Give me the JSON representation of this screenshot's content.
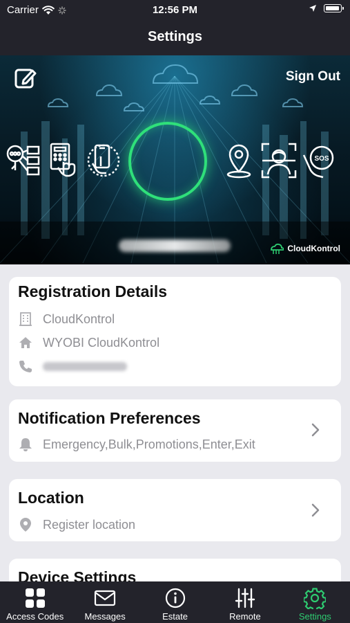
{
  "status_bar": {
    "carrier": "Carrier",
    "time": "12:56 PM"
  },
  "nav": {
    "title": "Settings"
  },
  "banner": {
    "sign_out_label": "Sign Out",
    "brand_name": "CloudKontrol",
    "feature_icons": [
      "access-control-icon",
      "keypad-icon",
      "phone-touch-icon",
      "location-pin-icon",
      "face-scan-icon",
      "sos-icon"
    ]
  },
  "registration": {
    "title": "Registration Details",
    "company": "CloudKontrol",
    "estate": "WYOBI CloudKontrol"
  },
  "notifications": {
    "title": "Notification Preferences",
    "summary": "Emergency,Bulk,Promotions,Enter,Exit"
  },
  "location": {
    "title": "Location",
    "value": "Register location"
  },
  "device": {
    "title": "Device Settings"
  },
  "tabs": [
    {
      "label": "Access Codes",
      "icon": "grid-icon",
      "active": false
    },
    {
      "label": "Messages",
      "icon": "envelope-icon",
      "active": false
    },
    {
      "label": "Estate",
      "icon": "info-icon",
      "active": false
    },
    {
      "label": "Remote",
      "icon": "sliders-icon",
      "active": false
    },
    {
      "label": "Settings",
      "icon": "gear-icon",
      "active": true
    }
  ],
  "colors": {
    "bar_bg": "#23232b",
    "accent": "#2ecc71",
    "page_bg": "#e9e9ee",
    "muted": "#8e8e93"
  }
}
